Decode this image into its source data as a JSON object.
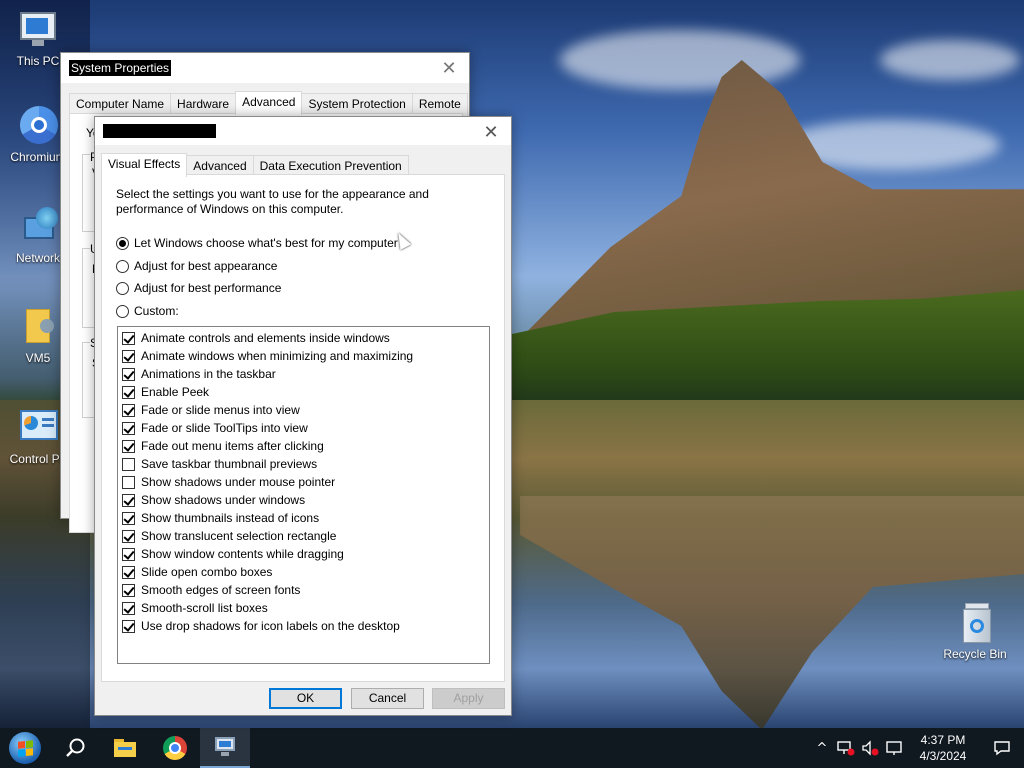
{
  "desktop": {
    "icons": [
      {
        "label": "This PC"
      },
      {
        "label": "Chromium"
      },
      {
        "label": "Network"
      },
      {
        "label": "VM5"
      },
      {
        "label": "Control Pa"
      },
      {
        "label": "Recycle Bin"
      }
    ]
  },
  "system_properties": {
    "title": "System Properties",
    "tabs": [
      "Computer Name",
      "Hardware",
      "Advanced",
      "System Protection",
      "Remote"
    ],
    "active_tab": "Advanced",
    "partial_text": [
      "Yo",
      "P",
      "V",
      "U",
      "D",
      "S",
      "S"
    ]
  },
  "performance_options": {
    "title": "",
    "tabs": [
      "Visual Effects",
      "Advanced",
      "Data Execution Prevention"
    ],
    "active_tab": "Visual Effects",
    "description": "Select the settings you want to use for the appearance and performance of Windows on this computer.",
    "radios": [
      {
        "label": "Let Windows choose what's best for my computer",
        "selected": true
      },
      {
        "label": "Adjust for best appearance",
        "selected": false
      },
      {
        "label": "Adjust for best performance",
        "selected": false
      },
      {
        "label": "Custom:",
        "selected": false
      }
    ],
    "effects": [
      {
        "label": "Animate controls and elements inside windows",
        "checked": true
      },
      {
        "label": "Animate windows when minimizing and maximizing",
        "checked": true
      },
      {
        "label": "Animations in the taskbar",
        "checked": true
      },
      {
        "label": "Enable Peek",
        "checked": true
      },
      {
        "label": "Fade or slide menus into view",
        "checked": true
      },
      {
        "label": "Fade or slide ToolTips into view",
        "checked": true
      },
      {
        "label": "Fade out menu items after clicking",
        "checked": true
      },
      {
        "label": "Save taskbar thumbnail previews",
        "checked": false
      },
      {
        "label": "Show shadows under mouse pointer",
        "checked": false
      },
      {
        "label": "Show shadows under windows",
        "checked": true
      },
      {
        "label": "Show thumbnails instead of icons",
        "checked": true
      },
      {
        "label": "Show translucent selection rectangle",
        "checked": true
      },
      {
        "label": "Show window contents while dragging",
        "checked": true
      },
      {
        "label": "Slide open combo boxes",
        "checked": true
      },
      {
        "label": "Smooth edges of screen fonts",
        "checked": true
      },
      {
        "label": "Smooth-scroll list boxes",
        "checked": true
      },
      {
        "label": "Use drop shadows for icon labels on the desktop",
        "checked": true
      }
    ],
    "buttons": {
      "ok": "OK",
      "cancel": "Cancel",
      "apply": "Apply"
    }
  },
  "taskbar": {
    "items": [
      "start-icon",
      "search-icon",
      "file-explorer-icon",
      "chrome-icon",
      "system-properties-icon"
    ],
    "clock": {
      "time": "4:37 PM",
      "date": "4/3/2024"
    },
    "tray_chevron": "^"
  }
}
